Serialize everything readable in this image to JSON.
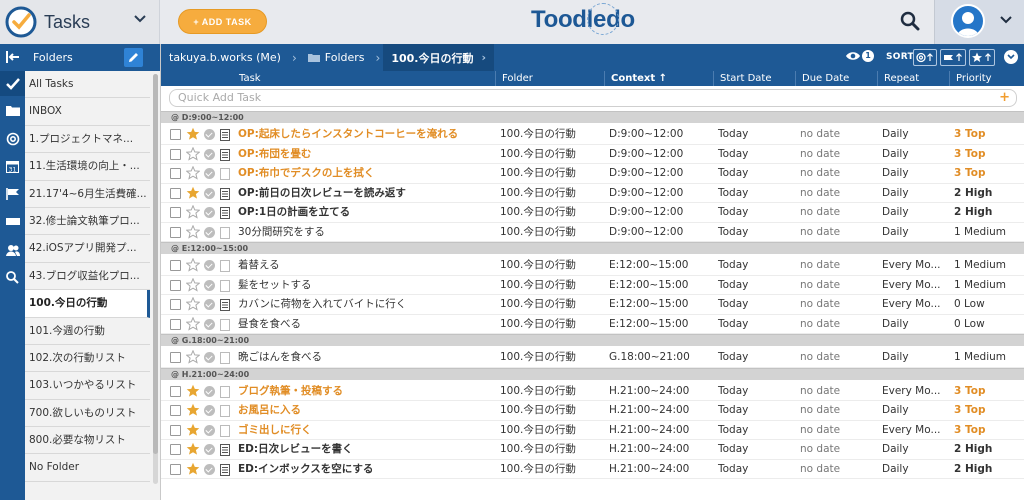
{
  "header": {
    "app_title": "Tasks",
    "add_task_label": "+ ADD TASK",
    "brand_pre": "Toodl",
    "brand_o": "e",
    "brand_post": "do"
  },
  "folders": {
    "title": "Folders",
    "items": [
      {
        "label": "All Tasks"
      },
      {
        "label": "INBOX"
      },
      {
        "label": "1.プロジェクトマネ..."
      },
      {
        "label": "11.生活環境の向上・..."
      },
      {
        "label": "21.17'4~6月生活費確..."
      },
      {
        "label": "32.修士論文執筆プロ..."
      },
      {
        "label": "42.iOSアプリ開発プ..."
      },
      {
        "label": "43.ブログ収益化プロ..."
      },
      {
        "label": "100.今日の行動"
      },
      {
        "label": "101.今週の行動"
      },
      {
        "label": "102.次の行動リスト"
      },
      {
        "label": "103.いつかやるリスト"
      },
      {
        "label": "700.欲しいものリスト"
      },
      {
        "label": "800.必要な物リスト"
      },
      {
        "label": "No Folder"
      }
    ]
  },
  "breadcrumb": {
    "user": "takuya.b.works (Me)",
    "folders": "Folders",
    "current": "100.今日の行動"
  },
  "toolbar": {
    "eye_count": "1",
    "sort_label": "SORT"
  },
  "columns": {
    "task": "Task",
    "folder": "Folder",
    "context": "Context ↑",
    "start": "Start Date",
    "due": "Due Date",
    "repeat": "Repeat",
    "priority": "Priority"
  },
  "quick_add": {
    "placeholder": "Quick Add Task",
    "plus": "+"
  },
  "groups": [
    {
      "label": "D:9:00~12:00",
      "rows": [
        {
          "name": "OP:起床したらインスタントコーヒーを淹れる",
          "star": true,
          "note": true,
          "style": "hot",
          "folder": "100.今日の行動",
          "context": "D:9:00~12:00",
          "start": "Today",
          "due": "no date",
          "repeat": "Daily",
          "priority": "3 Top"
        },
        {
          "name": "OP:布団を畳む",
          "star": false,
          "note": true,
          "style": "hot",
          "folder": "100.今日の行動",
          "context": "D:9:00~12:00",
          "start": "Today",
          "due": "no date",
          "repeat": "Daily",
          "priority": "3 Top"
        },
        {
          "name": "OP:布巾でデスクの上を拭く",
          "star": false,
          "note": false,
          "style": "hot",
          "folder": "100.今日の行動",
          "context": "D:9:00~12:00",
          "start": "Today",
          "due": "no date",
          "repeat": "Daily",
          "priority": "3 Top"
        },
        {
          "name": "OP:前日の日次レビューを読み返す",
          "star": true,
          "note": true,
          "style": "bold",
          "folder": "100.今日の行動",
          "context": "D:9:00~12:00",
          "start": "Today",
          "due": "no date",
          "repeat": "Daily",
          "priority": "2 High"
        },
        {
          "name": "OP:1日の計画を立てる",
          "star": false,
          "note": true,
          "style": "bold",
          "folder": "100.今日の行動",
          "context": "D:9:00~12:00",
          "start": "Today",
          "due": "no date",
          "repeat": "Daily",
          "priority": "2 High"
        },
        {
          "name": "30分間研究をする",
          "star": false,
          "note": false,
          "style": "",
          "folder": "100.今日の行動",
          "context": "D:9:00~12:00",
          "start": "Today",
          "due": "no date",
          "repeat": "Daily",
          "priority": "1 Medium"
        }
      ]
    },
    {
      "label": "E:12:00~15:00",
      "rows": [
        {
          "name": "着替える",
          "star": false,
          "note": false,
          "style": "",
          "folder": "100.今日の行動",
          "context": "E:12:00~15:00",
          "start": "Today",
          "due": "no date",
          "repeat": "Every Mo...",
          "priority": "1 Medium"
        },
        {
          "name": "髪をセットする",
          "star": false,
          "note": false,
          "style": "",
          "folder": "100.今日の行動",
          "context": "E:12:00~15:00",
          "start": "Today",
          "due": "no date",
          "repeat": "Every Mo...",
          "priority": "1 Medium"
        },
        {
          "name": "カバンに荷物を入れてバイトに行く",
          "star": false,
          "note": true,
          "style": "",
          "folder": "100.今日の行動",
          "context": "E:12:00~15:00",
          "start": "Today",
          "due": "no date",
          "repeat": "Every Mo...",
          "priority": "0 Low"
        },
        {
          "name": "昼食を食べる",
          "star": false,
          "note": false,
          "style": "",
          "folder": "100.今日の行動",
          "context": "E:12:00~15:00",
          "start": "Today",
          "due": "no date",
          "repeat": "Daily",
          "priority": "0 Low"
        }
      ]
    },
    {
      "label": "G.18:00~21:00",
      "rows": [
        {
          "name": "晩ごはんを食べる",
          "star": false,
          "note": false,
          "style": "",
          "folder": "100.今日の行動",
          "context": "G.18:00~21:00",
          "start": "Today",
          "due": "no date",
          "repeat": "Daily",
          "priority": "1 Medium"
        }
      ]
    },
    {
      "label": "H.21:00~24:00",
      "rows": [
        {
          "name": "ブログ執筆・投稿する",
          "star": true,
          "note": false,
          "style": "hot",
          "folder": "100.今日の行動",
          "context": "H.21:00~24:00",
          "start": "Today",
          "due": "no date",
          "repeat": "Every Mo...",
          "priority": "3 Top"
        },
        {
          "name": "お風呂に入る",
          "star": true,
          "note": false,
          "style": "hot",
          "folder": "100.今日の行動",
          "context": "H.21:00~24:00",
          "start": "Today",
          "due": "no date",
          "repeat": "Daily",
          "priority": "3 Top"
        },
        {
          "name": "ゴミ出しに行く",
          "star": true,
          "note": false,
          "style": "hot",
          "folder": "100.今日の行動",
          "context": "H.21:00~24:00",
          "start": "Today",
          "due": "no date",
          "repeat": "Every Mo...",
          "priority": "3 Top"
        },
        {
          "name": "ED:日次レビューを書く",
          "star": true,
          "note": true,
          "style": "bold",
          "folder": "100.今日の行動",
          "context": "H.21:00~24:00",
          "start": "Today",
          "due": "no date",
          "repeat": "Daily",
          "priority": "2 High"
        },
        {
          "name": "ED:インボックスを空にする",
          "star": true,
          "note": true,
          "style": "bold",
          "folder": "100.今日の行動",
          "context": "H.21:00~24:00",
          "start": "Today",
          "due": "no date",
          "repeat": "Daily",
          "priority": "2 High"
        }
      ]
    }
  ],
  "colors": {
    "brand_blue": "#1e5995",
    "accent_orange": "#f6ac3e",
    "star_gold": "#e8a631",
    "top_priority": "#e18d25"
  }
}
